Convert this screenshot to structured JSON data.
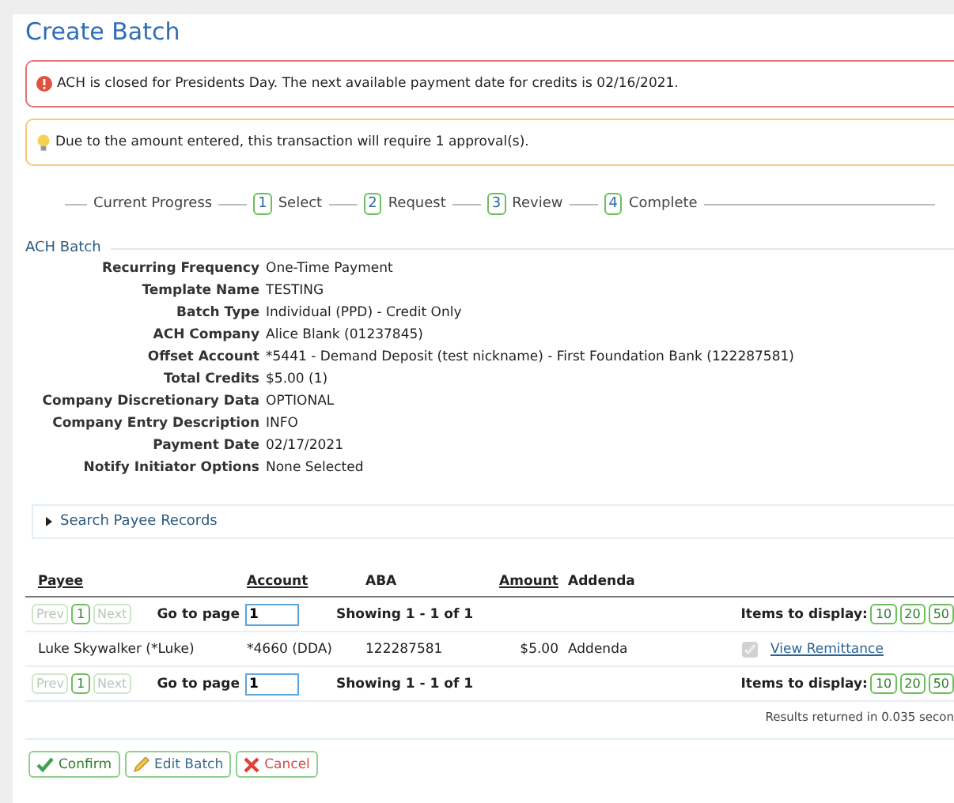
{
  "title": "Create Batch",
  "alerts": [
    {
      "kind": "error",
      "text": "ACH is closed for Presidents Day. The next available payment date for credits is 02/16/2021."
    },
    {
      "kind": "warning",
      "text": "Due to the amount entered, this transaction will require 1 approval(s)."
    }
  ],
  "progress": {
    "label": "Current Progress",
    "steps": [
      {
        "number": "1",
        "label": "Select"
      },
      {
        "number": "2",
        "label": "Request"
      },
      {
        "number": "3",
        "label": "Review"
      },
      {
        "number": "4",
        "label": "Complete"
      }
    ]
  },
  "section": {
    "title": "ACH Batch",
    "fields": [
      {
        "label": "Recurring Frequency",
        "value": "One-Time Payment"
      },
      {
        "label": "Template Name",
        "value": "TESTING"
      },
      {
        "label": "Batch Type",
        "value": "Individual (PPD) - Credit Only"
      },
      {
        "label": "ACH Company",
        "value": "Alice Blank (01237845)"
      },
      {
        "label": "Offset Account",
        "value": "*5441 - Demand Deposit (test nickname) - First Foundation Bank (122287581)"
      },
      {
        "label": "Total Credits",
        "value": "$5.00 (1)"
      },
      {
        "label": "Company Discretionary Data",
        "value": "OPTIONAL"
      },
      {
        "label": "Company Entry Description",
        "value": "INFO"
      },
      {
        "label": "Payment Date",
        "value": "02/17/2021"
      },
      {
        "label": "Notify Initiator Options",
        "value": "None Selected"
      }
    ]
  },
  "search_panel": {
    "label": "Search Payee Records",
    "expanded": false
  },
  "table": {
    "columns": [
      {
        "label": "Payee",
        "sortable": true
      },
      {
        "label": "Account",
        "sortable": true
      },
      {
        "label": "ABA",
        "sortable": false
      },
      {
        "label": "Amount",
        "sortable": true
      },
      {
        "label": "Addenda",
        "sortable": false
      }
    ],
    "pagers": [
      {
        "prev": "Prev",
        "pages": [
          {
            "label": "1",
            "selected": true
          }
        ],
        "next": "Next",
        "prev_disabled": true,
        "next_disabled": true,
        "goto_label": "Go to page",
        "goto_value": "1",
        "showing": "Showing 1 - 1 of 1",
        "items_label": "Items to display:",
        "items_options": [
          "10",
          "20",
          "50"
        ]
      },
      {
        "prev": "Prev",
        "pages": [
          {
            "label": "1",
            "selected": true
          }
        ],
        "next": "Next",
        "prev_disabled": true,
        "next_disabled": true,
        "goto_label": "Go to page",
        "goto_value": "1",
        "showing": "Showing 1 - 1 of 1",
        "items_label": "Items to display:",
        "items_options": [
          "10",
          "20",
          "50"
        ]
      }
    ],
    "rows": [
      {
        "payee": "Luke Skywalker (*Luke)",
        "account": "*4660 (DDA)",
        "aba": "122287581",
        "amount": "$5.00",
        "addenda": "Addenda",
        "checked": true,
        "link": "View Remittance"
      }
    ]
  },
  "results_note": "Results returned in 0.035 secon",
  "buttons": [
    {
      "kind": "confirm",
      "label": "Confirm"
    },
    {
      "kind": "edit",
      "label": "Edit Batch"
    },
    {
      "kind": "cancel",
      "label": "Cancel"
    }
  ]
}
